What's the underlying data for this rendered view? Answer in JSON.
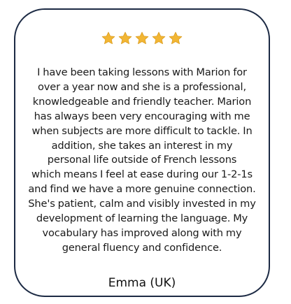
{
  "testimonial": {
    "rating": 5,
    "rating_max": 5,
    "star_color": "#f2b634",
    "border_color": "#1c2a44",
    "review_lines": [
      "I have been taking lessons with Marion for",
      "over a year now and she is a professional,",
      "knowledgeable and friendly teacher. Marion",
      "has always been very encouraging with me",
      "when subjects are more difficult to tackle. In",
      "addition, she takes an interest in my",
      "personal life outside of French lessons",
      "which means I feel at ease during our 1-2-1s",
      "and find we have a more genuine connection.",
      "She's patient, calm and visibly invested in my",
      "development of learning the language. My",
      "vocabulary has improved along with my",
      "general fluency and confidence."
    ],
    "author": "Emma (UK)"
  }
}
